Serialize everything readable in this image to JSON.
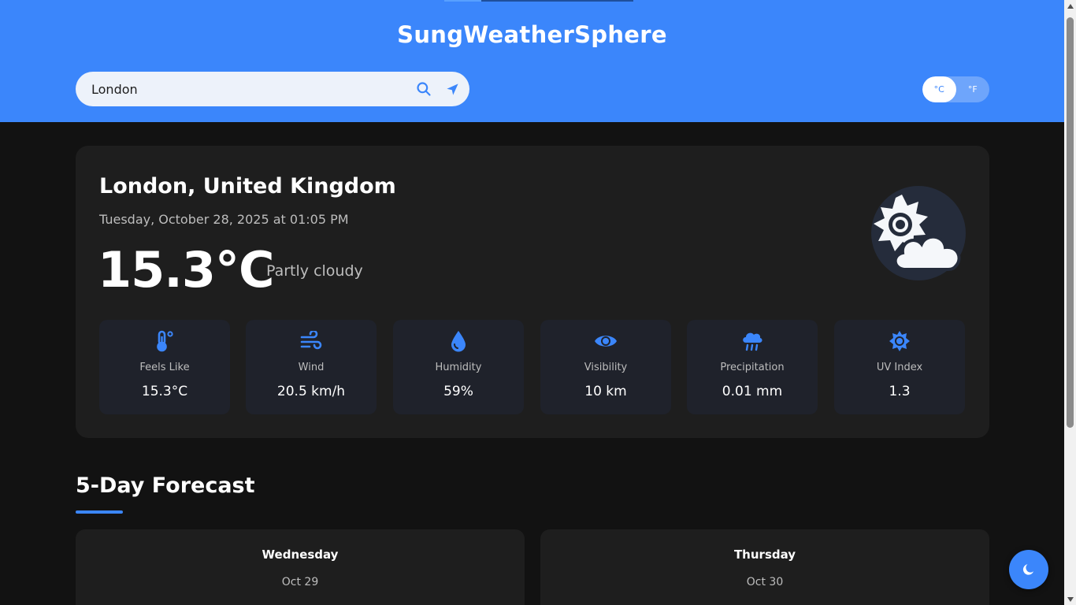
{
  "app": {
    "title": "SungWeatherSphere"
  },
  "search": {
    "value": "London",
    "placeholder": ""
  },
  "units": {
    "celsius_label": "°C",
    "fahrenheit_label": "°F",
    "active": "celsius"
  },
  "current": {
    "location": "London, United Kingdom",
    "datetime": "Tuesday, October 28, 2025 at 01:05 PM",
    "temperature": "15.3°C",
    "condition": "Partly cloudy",
    "icon": "partly-cloudy-icon"
  },
  "stats": [
    {
      "icon": "thermometer-icon",
      "label": "Feels Like",
      "value": "15.3°C"
    },
    {
      "icon": "wind-icon",
      "label": "Wind",
      "value": "20.5 km/h"
    },
    {
      "icon": "humidity-drop-icon",
      "label": "Humidity",
      "value": "59%"
    },
    {
      "icon": "eye-icon",
      "label": "Visibility",
      "value": "10 km"
    },
    {
      "icon": "rain-cloud-icon",
      "label": "Precipitation",
      "value": "0.01 mm"
    },
    {
      "icon": "sun-uv-icon",
      "label": "UV Index",
      "value": "1.3"
    }
  ],
  "forecast": {
    "title": "5-Day Forecast",
    "days": [
      {
        "day": "Wednesday",
        "date": "Oct 29"
      },
      {
        "day": "Thursday",
        "date": "Oct 30"
      }
    ]
  },
  "colors": {
    "accent": "#3b86fb",
    "background": "#121212",
    "card": "#1e1e1e"
  }
}
